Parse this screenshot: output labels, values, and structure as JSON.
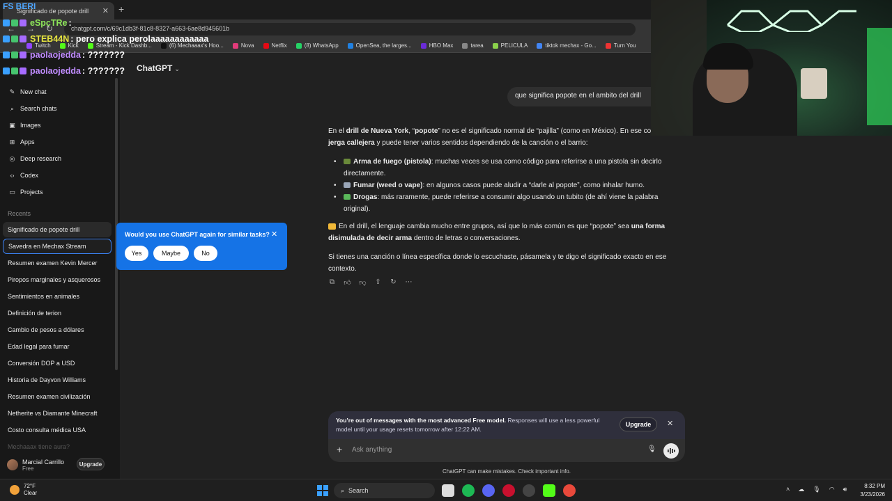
{
  "browser": {
    "tab_title": "Significado de popote drill",
    "url": "chatgpt.com/c/69c1db3f-81c8-8327-a663-6ae8d945601b",
    "bookmarks": [
      "Twitch",
      "Kick",
      "Stream - Kick Dashb...",
      "(6) Mechaaax's Hoo...",
      "Nova",
      "Netflix",
      "(8) WhatsApp",
      "OpenSea, the larges...",
      "HBO Max",
      "tarea",
      "PELICULA",
      "tiktok mechax - Go...",
      "Turn You"
    ]
  },
  "sidebar": {
    "items": [
      {
        "label": "New chat",
        "icon": "edit-icon"
      },
      {
        "label": "Search chats",
        "icon": "search-icon"
      },
      {
        "label": "Images",
        "icon": "image-icon"
      },
      {
        "label": "Apps",
        "icon": "apps-icon"
      },
      {
        "label": "Deep research",
        "icon": "telescope-icon"
      },
      {
        "label": "Codex",
        "icon": "code-icon"
      },
      {
        "label": "Projects",
        "icon": "folder-icon"
      }
    ],
    "recents_title": "Recents",
    "recents": [
      "Significado de popote drill",
      "Savedra en Mechax Stream",
      "Resumen examen Kevin Mercer",
      "Piropos marginales y asquerosos",
      "Sentimientos en animales",
      "Definición de terion",
      "Cambio de pesos a dólares",
      "Edad legal para fumar",
      "Conversión DOP a USD",
      "Historia de Dayvon Williams",
      "Resumen examen civilización",
      "Netherite vs Diamante Minecraft",
      "Costo consulta médica USA",
      "Mechaaax tiene aura?"
    ],
    "user_name": "Marcial Carrillo",
    "user_plan": "Free",
    "upgrade_label": "Upgrade"
  },
  "main": {
    "title": "ChatGPT",
    "user_message": "que significa popote en el ambito del drill",
    "answer": {
      "intro_1": "En el ",
      "intro_b1": "drill de Nueva York",
      "intro_2": ", “",
      "intro_b2": "popote",
      "intro_3": "” no es el significado normal de “pajilla” (como en México). En ese contexto es ",
      "intro_b3": "jerga callejera",
      "intro_4": " y puede tener varios sentidos dependiendo de la canción o el barrio:",
      "bullets": [
        {
          "bold": "Arma de fuego (pistola)",
          "text": ": muchas veces se usa como código para referirse a una pistola sin decirlo directamente."
        },
        {
          "bold": "Fumar (weed o vape)",
          "text": ": en algunos casos puede aludir a “darle al popote”, como inhalar humo."
        },
        {
          "bold": "Drogas",
          "text": ": más raramente, puede referirse a consumir algo usando un tubito (de ahí viene la palabra original)."
        }
      ],
      "para2_a": "En el drill, el lenguaje cambia mucho entre grupos, así que lo más común es que “popote” sea ",
      "para2_b": "una forma disimulada de decir arma",
      "para2_c": " dentro de letras o conversaciones.",
      "para3": "Si tienes una canción o línea específica donde lo escuchaste, pásamela y te digo el significado exacto en ese contexto."
    }
  },
  "popup": {
    "question": "Would you use ChatGPT again for similar tasks?",
    "yes": "Yes",
    "maybe": "Maybe",
    "no": "No"
  },
  "limit_banner": {
    "bold": "You’re out of messages with the most advanced Free model.",
    "text": " Responses will use a less powerful model until your usage resets tomorrow after 12:22 AM.",
    "upgrade": "Upgrade"
  },
  "composer": {
    "placeholder": "Ask anything",
    "disclaimer": "ChatGPT can make mistakes. Check important info."
  },
  "stream_chat": [
    {
      "user": "eSpcTRe",
      "msg": " :",
      "color": "#8ee65a"
    },
    {
      "user": "STEB44N",
      "msg": " : pero explica perolaaaaaaaaaaaa",
      "color": "#e8e640"
    },
    {
      "user": "paolaojedda",
      "msg": " : ???????",
      "color": "#c08cff"
    },
    {
      "user": "paolaojedda",
      "msg": " : ???????",
      "color": "#c08cff"
    }
  ],
  "stream_overlay_top": "FS BERI",
  "taskbar": {
    "temp": "72°F",
    "condition": "Clear",
    "search": "Search",
    "time": "8:32 PM",
    "date": "3/23/2026"
  },
  "colors": {
    "accent_blue": "#1573e6",
    "background": "#212121",
    "sidebar": "#181818"
  }
}
